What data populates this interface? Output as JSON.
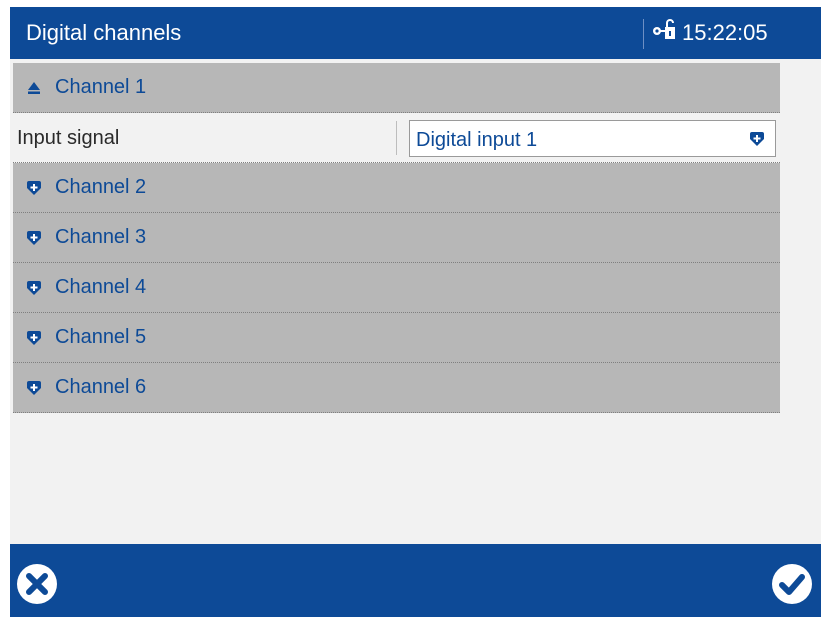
{
  "header": {
    "title": "Digital channels",
    "time": "15:22:05",
    "status_icon": "unlocked-key-icon"
  },
  "channels": [
    {
      "label": "Channel 1",
      "expanded": true
    },
    {
      "label": "Channel 2",
      "expanded": false
    },
    {
      "label": "Channel 3",
      "expanded": false
    },
    {
      "label": "Channel 4",
      "expanded": false
    },
    {
      "label": "Channel 5",
      "expanded": false
    },
    {
      "label": "Channel 6",
      "expanded": false
    }
  ],
  "channel1_params": {
    "input_signal_label": "Input signal",
    "input_signal_value": "Digital input 1"
  },
  "footer": {
    "cancel_icon": "cancel-icon",
    "confirm_icon": "checkmark-icon"
  },
  "colors": {
    "brand_blue": "#0d4a97",
    "group_gray": "#b7b7b7",
    "background": "#f2f2f2"
  }
}
